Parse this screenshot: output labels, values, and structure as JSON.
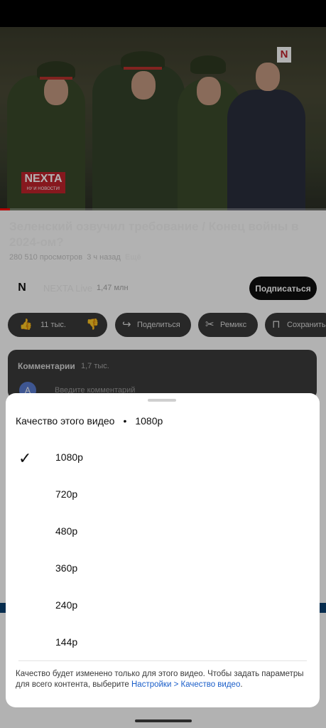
{
  "video": {
    "title": "Зеленский озвучил требование / Конец войны в 2024-ом?",
    "views": "280 510 просмотров",
    "age": "3 ч назад",
    "more": "Ещё",
    "logo_text": "NEXTA",
    "logo_sub": "НУ И НОВОСТИ!",
    "progress": 0.03
  },
  "channel": {
    "avatar": "N",
    "name": "NEXTA Live",
    "subscribers": "1,47 млн",
    "subscribe_label": "Подписаться"
  },
  "actions": {
    "likes": "11 тыс.",
    "share": "Поделиться",
    "remix": "Ремикс",
    "save": "Сохранить"
  },
  "comments": {
    "title": "Комментарии",
    "count": "1,7 тыс.",
    "avatar_letter": "A",
    "placeholder": "Введите комментарий"
  },
  "quality_sheet": {
    "header_label": "Качество этого видео",
    "header_separator": "•",
    "current": "1080p",
    "options": [
      {
        "label": "1080p",
        "selected": true
      },
      {
        "label": "720p",
        "selected": false
      },
      {
        "label": "480p",
        "selected": false
      },
      {
        "label": "360p",
        "selected": false
      },
      {
        "label": "240p",
        "selected": false
      },
      {
        "label": "144p",
        "selected": false
      }
    ],
    "footnote_text": "Качество будет изменено только для этого видео. Чтобы задать параметры для всего контента, выберите ",
    "footnote_link": "Настройки > Качество видео",
    "footnote_end": "."
  },
  "colors": {
    "accent_link": "#1a5ec9",
    "subscribe_bg": "#0f0f0f",
    "brand_red": "#c0232b"
  }
}
